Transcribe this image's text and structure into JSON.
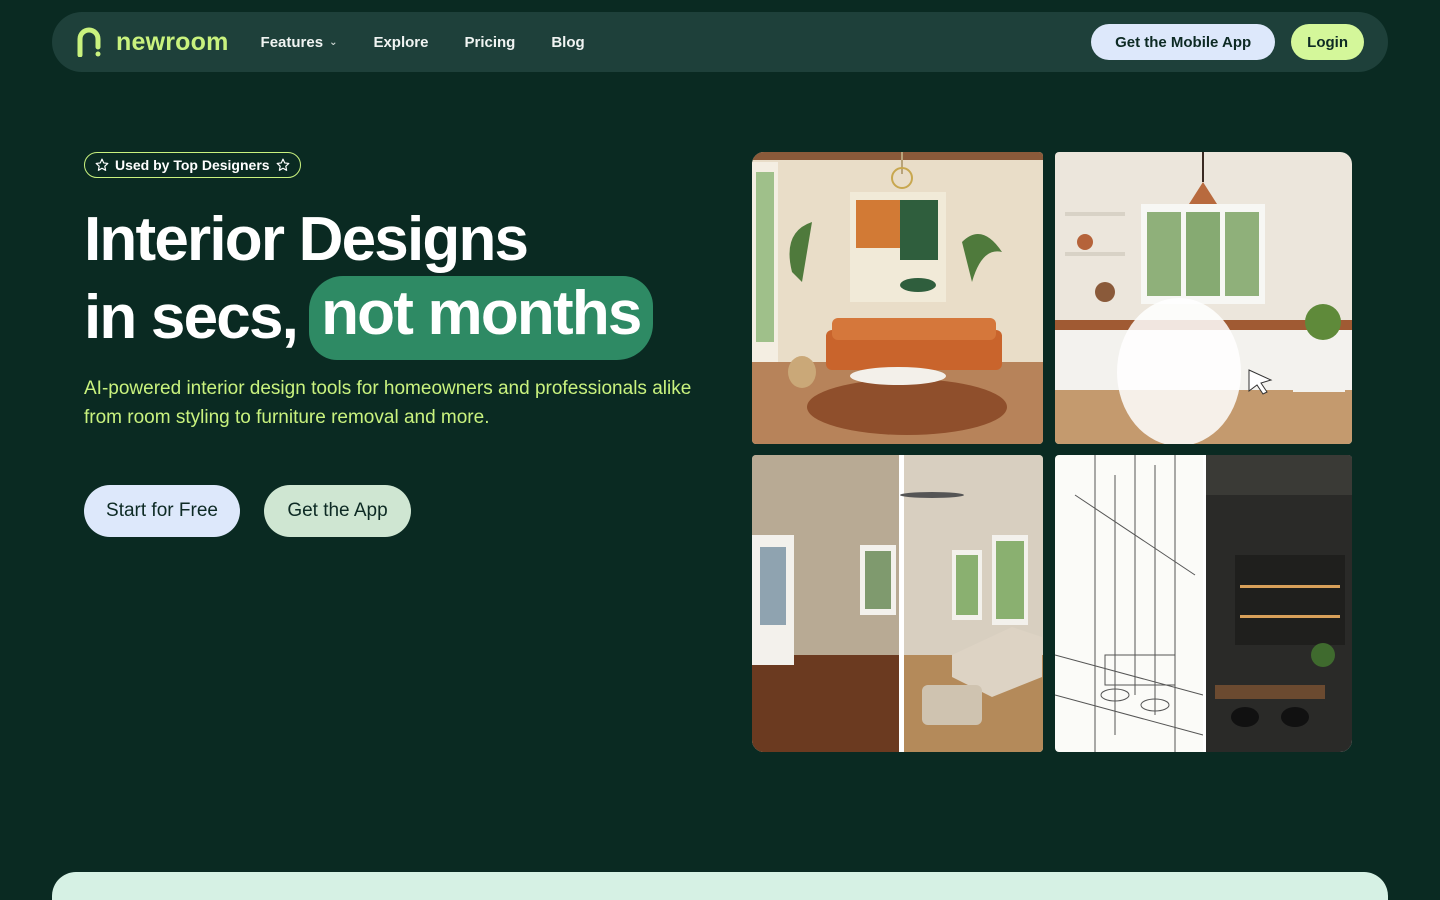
{
  "brand": {
    "name": "newroom",
    "accent": "#c9f27e",
    "background": "#0a2a22"
  },
  "nav": {
    "links": [
      {
        "label": "Features",
        "has_dropdown": true
      },
      {
        "label": "Explore"
      },
      {
        "label": "Pricing"
      },
      {
        "label": "Blog"
      }
    ],
    "mobile_app_button": "Get the Mobile App",
    "login_button": "Login"
  },
  "hero": {
    "badge": "Used by Top Designers",
    "headline_line1": "Interior Designs",
    "headline_line2_plain": "in secs,",
    "headline_line2_highlight": "not months",
    "subtext": "AI-powered interior design tools for homeowners and professionals alike from room styling to furniture removal and more.",
    "primary_cta": "Start for Free",
    "secondary_cta": "Get the App",
    "highlight_color": "#2e8a64"
  },
  "gallery": {
    "images": [
      {
        "name": "living-room-image",
        "subject": "living room with orange sofa and abstract art"
      },
      {
        "name": "kitchen-image",
        "subject": "white kitchen with furniture removal cursor"
      },
      {
        "name": "empty-vs-furnished-room-image",
        "subject": "empty room split with furnished room"
      },
      {
        "name": "sketch-to-render-image",
        "subject": "sketch split with dark rendered dining room"
      }
    ]
  }
}
